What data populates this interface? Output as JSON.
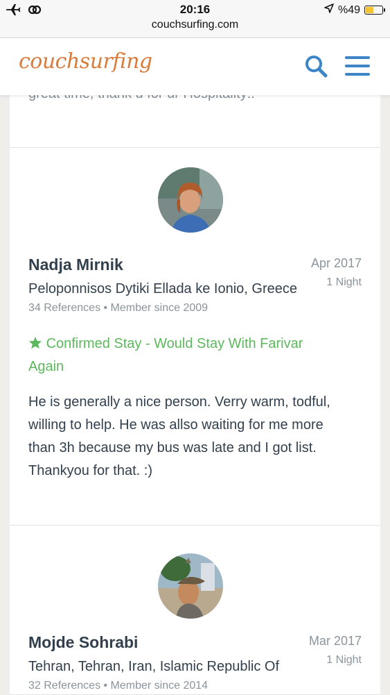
{
  "status_bar": {
    "time": "20:16",
    "url": "couchsurfing.com",
    "battery_text": "%49",
    "battery_level": 0.49,
    "icons": [
      "airplane-icon",
      "link-icon",
      "location-arrow-icon",
      "battery-icon"
    ]
  },
  "header": {
    "logo": "couchsurfing",
    "search_icon": "search-icon",
    "menu_icon": "hamburger-menu-icon",
    "accent_color": "#3d85c6",
    "logo_color": "#d97b3a"
  },
  "previous_review": {
    "snippet": "great time, thank u for ur Hospitality!!"
  },
  "reviews": [
    {
      "name": "Nadja Mirnik",
      "date": "Apr 2017",
      "nights": "1 Night",
      "location": "Peloponnisos Dytiki Ellada ke Ionio, Greece",
      "meta": "34 References • Member since 2009",
      "confirmed_line1": "Confirmed Stay - Would Stay With Farivar",
      "confirmed_line2": "Again",
      "text_lines": [
        "He is generally a nice person. Verry warm, todful,",
        "willing to help. He was allso waiting for me more",
        "than 3h because my bus was late and I got list.",
        "Thankyou for that. :)"
      ]
    },
    {
      "name": "Mojde Sohrabi",
      "date": "Mar 2017",
      "nights": "1 Night",
      "location": "Tehran, Tehran, Iran, Islamic Republic Of",
      "meta": "32 References • Member since 2014"
    }
  ],
  "colors": {
    "confirmed_green": "#5cb85c",
    "muted_gray": "#8a949c",
    "text_dark": "#32404d"
  }
}
